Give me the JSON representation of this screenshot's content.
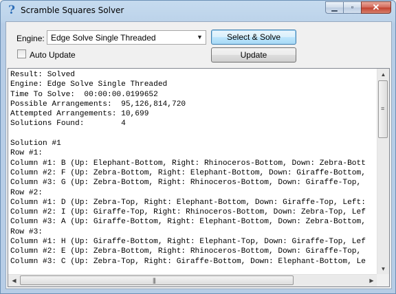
{
  "window": {
    "title": "Scramble Squares Solver",
    "icon": "question-mark-icon"
  },
  "caption_buttons": {
    "minimize": "▁",
    "maximize": "▫",
    "close": "✕"
  },
  "engine": {
    "label": "Engine:",
    "selected": "Edge Solve Single Threaded"
  },
  "buttons": {
    "select_solve": "Select & Solve",
    "update": "Update"
  },
  "auto_update": {
    "label": "Auto Update",
    "checked": false
  },
  "results": {
    "lines": [
      "Result: Solved",
      "Engine: Edge Solve Single Threaded",
      "Time To Solve:  00:00:00.0199652",
      "Possible Arrangements:  95,126,814,720",
      "Attempted Arrangements: 10,699",
      "Solutions Found:        4",
      "",
      "Solution #1",
      "Row #1:",
      "Column #1: B (Up: Elephant-Bottom, Right: Rhinoceros-Bottom, Down: Zebra-Bott",
      "Column #2: F (Up: Zebra-Bottom, Right: Elephant-Bottom, Down: Giraffe-Bottom,",
      "Column #3: G (Up: Zebra-Bottom, Right: Rhinoceros-Bottom, Down: Giraffe-Top,",
      "Row #2:",
      "Column #1: D (Up: Zebra-Top, Right: Elephant-Bottom, Down: Giraffe-Top, Left:",
      "Column #2: I (Up: Giraffe-Top, Right: Rhinoceros-Bottom, Down: Zebra-Top, Lef",
      "Column #3: A (Up: Giraffe-Bottom, Right: Elephant-Bottom, Down: Zebra-Bottom,",
      "Row #3:",
      "Column #1: H (Up: Giraffe-Bottom, Right: Elephant-Top, Down: Giraffe-Top, Lef",
      "Column #2: E (Up: Zebra-Bottom, Right: Rhinoceros-Bottom, Down: Giraffe-Top,",
      "Column #3: C (Up: Zebra-Top, Right: Giraffe-Bottom, Down: Elephant-Bottom, Le"
    ]
  }
}
